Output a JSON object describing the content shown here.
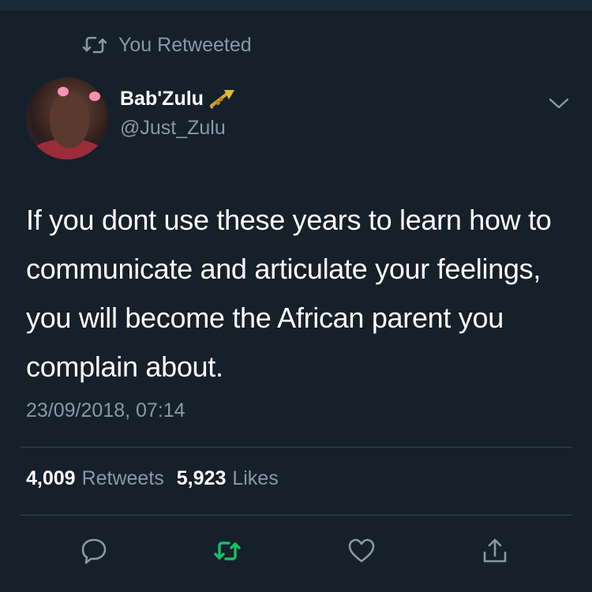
{
  "retweet_context": {
    "label": "You Retweeted",
    "icon": "retweet-icon"
  },
  "author": {
    "display_name": "Bab'Zulu",
    "name_emoji": "trumpet-icon",
    "handle": "@Just_Zulu"
  },
  "tweet": {
    "text": "If you dont use these years to learn how to communicate and articulate your feelings, you will become the African parent you complain about.",
    "timestamp": "23/09/2018, 07:14"
  },
  "stats": {
    "retweets_count": "4,009",
    "retweets_label": "Retweets",
    "likes_count": "5,923",
    "likes_label": "Likes"
  },
  "actions": [
    {
      "name": "reply",
      "icon": "reply-icon"
    },
    {
      "name": "retweet",
      "icon": "retweet-icon",
      "active": true
    },
    {
      "name": "like",
      "icon": "heart-icon"
    },
    {
      "name": "share",
      "icon": "share-icon"
    }
  ],
  "colors": {
    "background": "#15202b",
    "secondary_text": "#8899a6",
    "retweet_active": "#17bf63",
    "divider": "#38444d"
  }
}
